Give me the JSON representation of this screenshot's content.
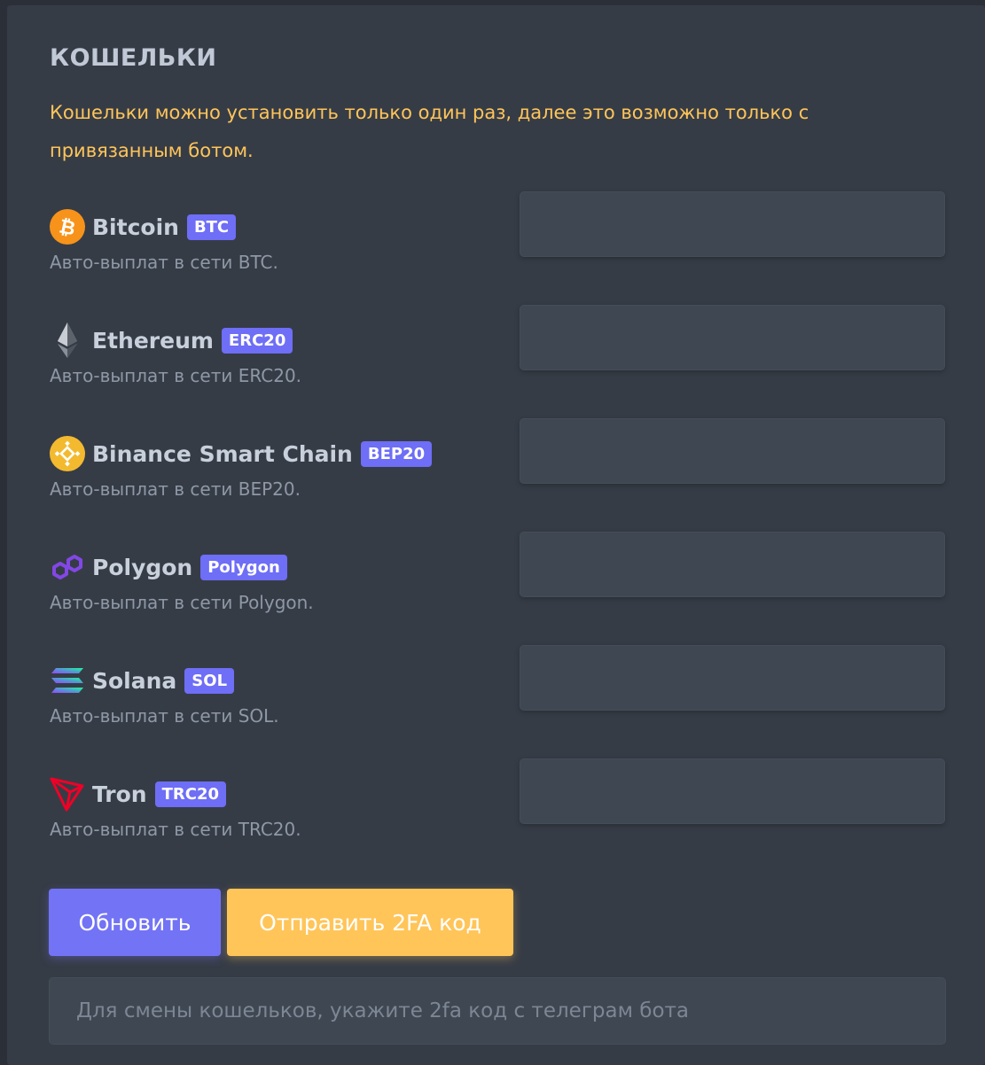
{
  "section": {
    "title": "КОШЕЛЬКИ",
    "notice": "Кошельки можно установить только один раз, далее это возможно только с привязанным ботом.",
    "accent_color": "#ffc559",
    "badge_color": "#6e6ef6"
  },
  "wallets": [
    {
      "name": "Bitcoin",
      "badge": "BTC",
      "description": "Авто-выплат в сети BTC.",
      "icon": "bitcoin-icon",
      "value": ""
    },
    {
      "name": "Ethereum",
      "badge": "ERC20",
      "description": "Авто-выплат в сети ERC20.",
      "icon": "ethereum-icon",
      "value": ""
    },
    {
      "name": "Binance Smart Chain",
      "badge": "BEP20",
      "description": "Авто-выплат в сети BEP20.",
      "icon": "binance-icon",
      "value": ""
    },
    {
      "name": "Polygon",
      "badge": "Polygon",
      "description": "Авто-выплат в сети Polygon.",
      "icon": "polygon-icon",
      "value": ""
    },
    {
      "name": "Solana",
      "badge": "SOL",
      "description": "Авто-выплат в сети SOL.",
      "icon": "solana-icon",
      "value": ""
    },
    {
      "name": "Tron",
      "badge": "TRC20",
      "description": "Авто-выплат в сети TRC20.",
      "icon": "tron-icon",
      "value": ""
    }
  ],
  "actions": {
    "update_label": "Обновить",
    "update_color": "#7373f5",
    "send_2fa_label": "Отправить 2FA код",
    "send_2fa_color": "#ffc559"
  },
  "two_fa": {
    "value": "",
    "placeholder": "Для смены кошельков, укажите 2fa код с телеграм бота"
  }
}
